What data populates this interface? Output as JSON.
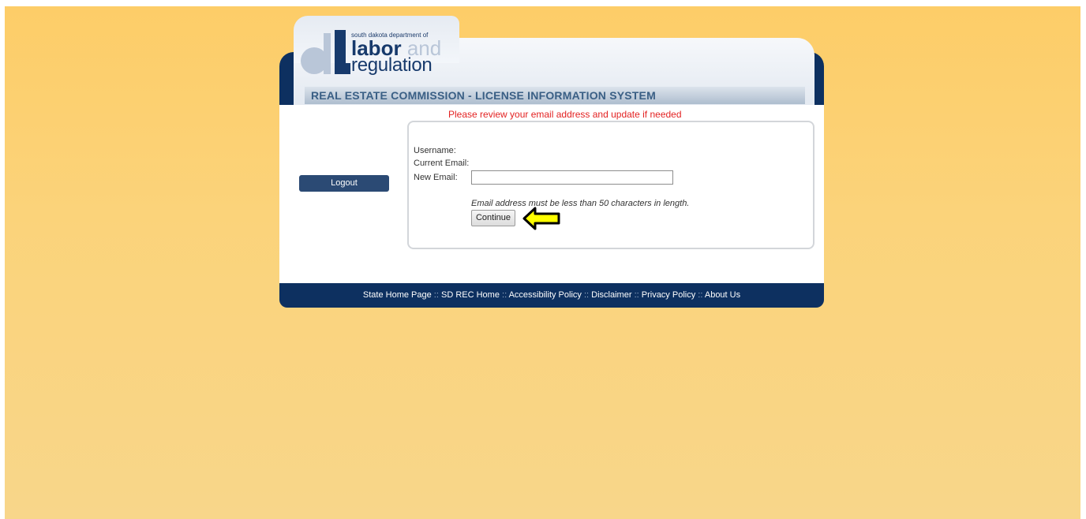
{
  "header": {
    "logo": {
      "dept_prefix": "south dakota department of",
      "word_labor": "labor",
      "word_and": "and",
      "word_regulation": "regulation"
    },
    "system_title": "REAL ESTATE COMMISSION - LICENSE INFORMATION SYSTEM"
  },
  "notice": "Please review your email address and update if needed",
  "sidebar": {
    "logout_label": "Logout"
  },
  "form": {
    "username_label": "Username:",
    "current_email_label": "Current Email:",
    "new_email_label": "New Email:",
    "new_email_value": "",
    "hint": "Email address must be less than 50 characters in length.",
    "continue_label": "Continue"
  },
  "footer": {
    "links": [
      "State Home Page",
      "SD REC Home",
      "Accessibility Policy",
      "Disclaimer",
      "Privacy Policy",
      "About Us"
    ],
    "separator": "::"
  },
  "colors": {
    "background": "#fdcd68",
    "navy": "#0d3060",
    "notice_red": "#e32222",
    "arrow_fill": "#ffff00"
  }
}
